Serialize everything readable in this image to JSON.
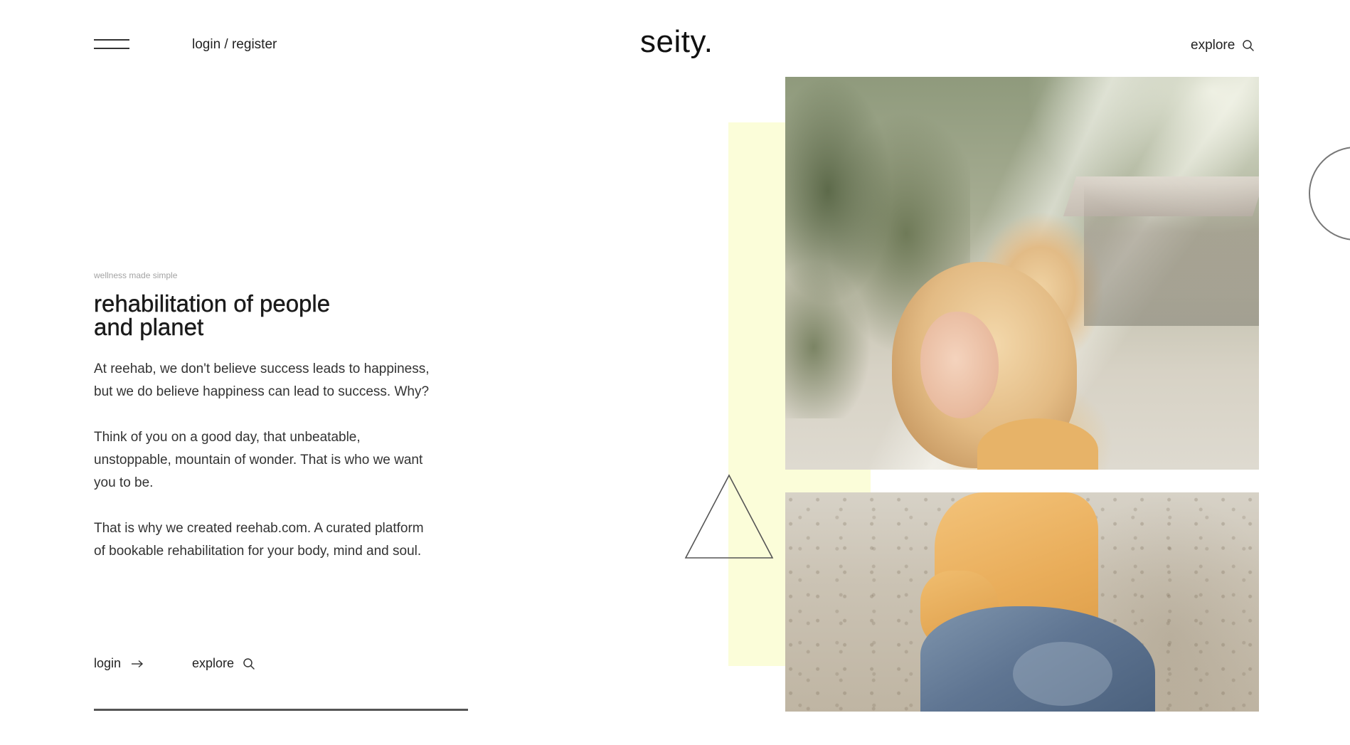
{
  "header": {
    "login_register": "login / register",
    "logo": "seity.",
    "explore": "explore",
    "menu_icon": "hamburger-menu-icon",
    "search_icon": "search-icon"
  },
  "hero": {
    "eyebrow": "wellness made simple",
    "headline_line1": "rehabilitation of people",
    "headline_line2": "and planet",
    "paragraphs": [
      "At reehab, we don't believe success leads to happiness, but we do believe happiness can lead to success. Why?",
      "Think of you on a good day, that unbeatable, unstoppable, mountain of wonder. That is who we want you to be.",
      "That is why we created reehab.com. A curated platform of bookable rehabilitation for your body, mind and soul."
    ],
    "cta_login": "login",
    "cta_login_icon": "arrow-right-icon",
    "cta_explore": "explore",
    "cta_explore_icon": "search-icon"
  },
  "colors": {
    "accent_yellow": "#fbfdd9",
    "text_dark": "#222222",
    "text_muted": "#a3a3a3"
  },
  "images": {
    "top_photo": "woman with blonde hair laughing outdoors",
    "bottom_photo": "woman in yellow shirt and denim jacket on gravel path"
  }
}
